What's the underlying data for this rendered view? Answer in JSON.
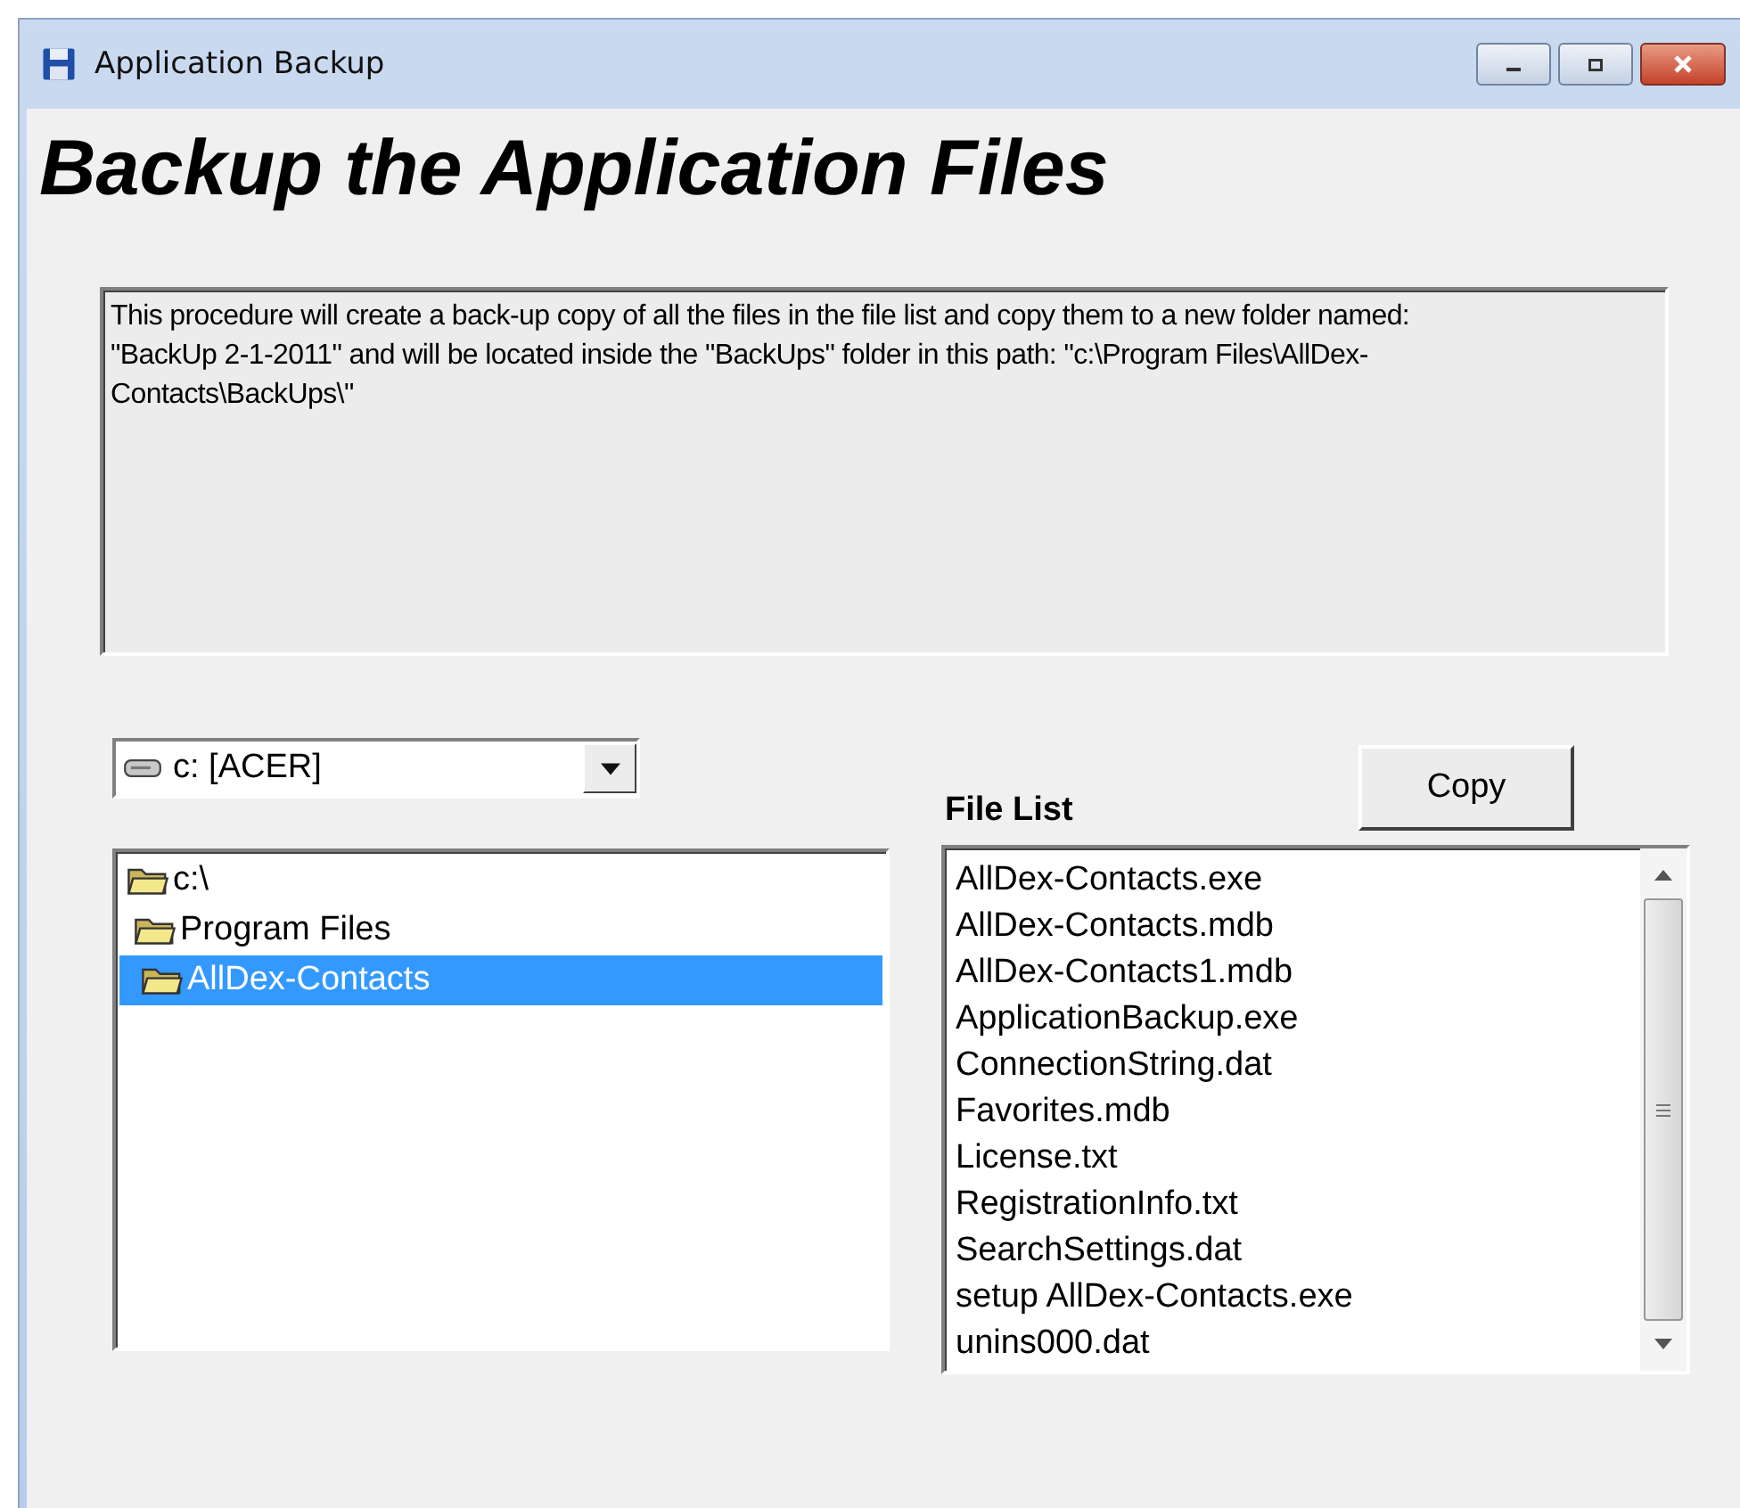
{
  "window": {
    "title": "Application Backup"
  },
  "heading": "Backup the Application Files",
  "description": "This procedure will create a back-up copy of all the files in the file list and copy them to a new folder named: \"BackUp 2-1-2011\" and will be located inside the \"BackUps\" folder in this path: \"c:\\Program Files\\AllDex-Contacts\\BackUps\\\"",
  "drive_select": {
    "value": "c: [ACER]"
  },
  "folder_tree": [
    {
      "label": "c:\\",
      "selected": false,
      "children": [
        {
          "label": "Program Files",
          "selected": false,
          "children": [
            {
              "label": "AllDex-Contacts",
              "selected": true
            }
          ]
        }
      ]
    }
  ],
  "copy_button": "Copy",
  "file_list": {
    "label": "File List",
    "items": [
      {
        "label": "AllDex-Contacts.exe"
      },
      {
        "label": "AllDex-Contacts.mdb"
      },
      {
        "label": "AllDex-Contacts1.mdb"
      },
      {
        "label": "ApplicationBackup.exe"
      },
      {
        "label": "ConnectionString.dat"
      },
      {
        "label": "Favorites.mdb"
      },
      {
        "label": "License.txt"
      },
      {
        "label": "RegistrationInfo.txt"
      },
      {
        "label": "SearchSettings.dat"
      },
      {
        "label": "setup AllDex-Contacts.exe"
      },
      {
        "label": "unins000.dat"
      }
    ]
  }
}
